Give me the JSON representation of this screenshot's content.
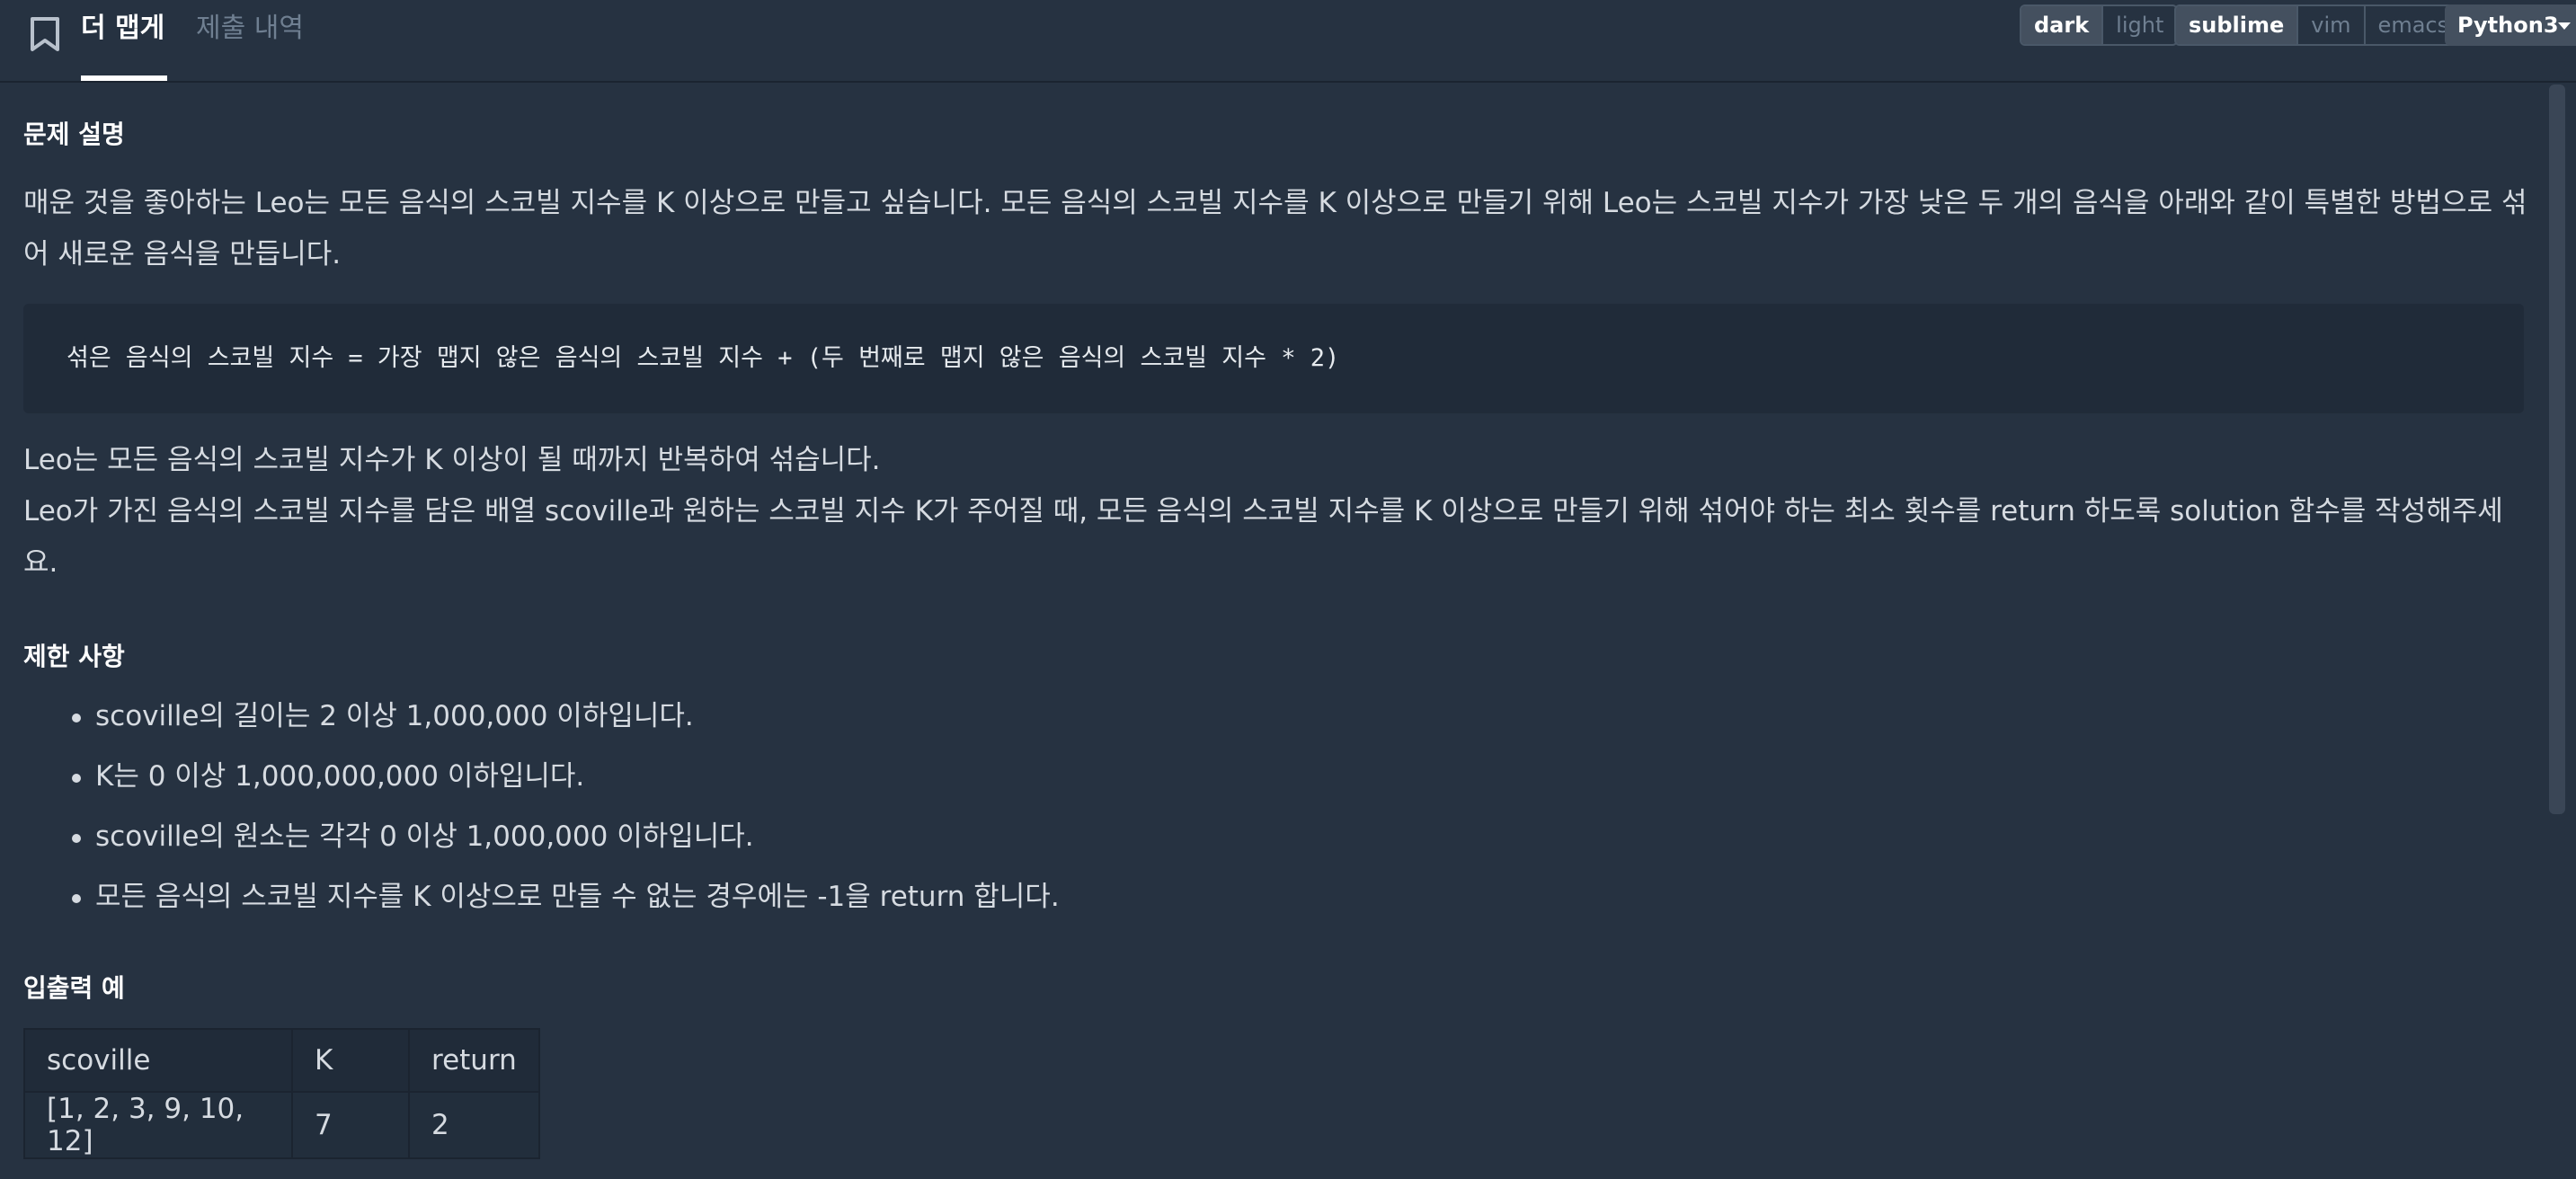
{
  "header": {
    "tabs": [
      {
        "label": "더 맵게",
        "active": true
      },
      {
        "label": "제출 내역",
        "active": false
      }
    ],
    "theme_options": [
      "dark",
      "light"
    ],
    "theme_selected": "dark",
    "keymap_options": [
      "sublime",
      "vim",
      "emacs"
    ],
    "keymap_selected": "sublime",
    "language": "Python3"
  },
  "problem": {
    "description_heading": "문제 설명",
    "intro": "매운 것을 좋아하는 Leo는 모든 음식의 스코빌 지수를 K 이상으로 만들고 싶습니다. 모든 음식의 스코빌 지수를 K 이상으로 만들기 위해 Leo는 스코빌 지수가 가장 낮은 두 개의 음식을 아래와 같이 특별한 방법으로 섞어 새로운 음식을 만듭니다.",
    "formula": "섞은 음식의 스코빌 지수 = 가장 맵지 않은 음식의 스코빌 지수 + (두 번째로 맵지 않은 음식의 스코빌 지수 * 2)",
    "line1": "Leo는 모든 음식의 스코빌 지수가 K 이상이 될 때까지 반복하여 섞습니다.",
    "line2": "Leo가 가진 음식의 스코빌 지수를 담은 배열 scoville과 원하는 스코빌 지수 K가 주어질 때, 모든 음식의 스코빌 지수를 K 이상으로 만들기 위해 섞어야 하는 최소 횟수를 return 하도록 solution 함수를 작성해주세요.",
    "constraints_heading": "제한 사항",
    "constraints": [
      "scoville의 길이는 2 이상 1,000,000 이하입니다.",
      "K는 0 이상 1,000,000,000 이하입니다.",
      "scoville의 원소는 각각 0 이상 1,000,000 이하입니다.",
      "모든 음식의 스코빌 지수를 K 이상으로 만들 수 없는 경우에는 -1을 return 합니다."
    ],
    "examples_heading": "입출력 예",
    "table": {
      "headers": [
        "scoville",
        "K",
        "return"
      ],
      "rows": [
        [
          "[1, 2, 3, 9, 10, 12]",
          "7",
          "2"
        ]
      ]
    }
  }
}
